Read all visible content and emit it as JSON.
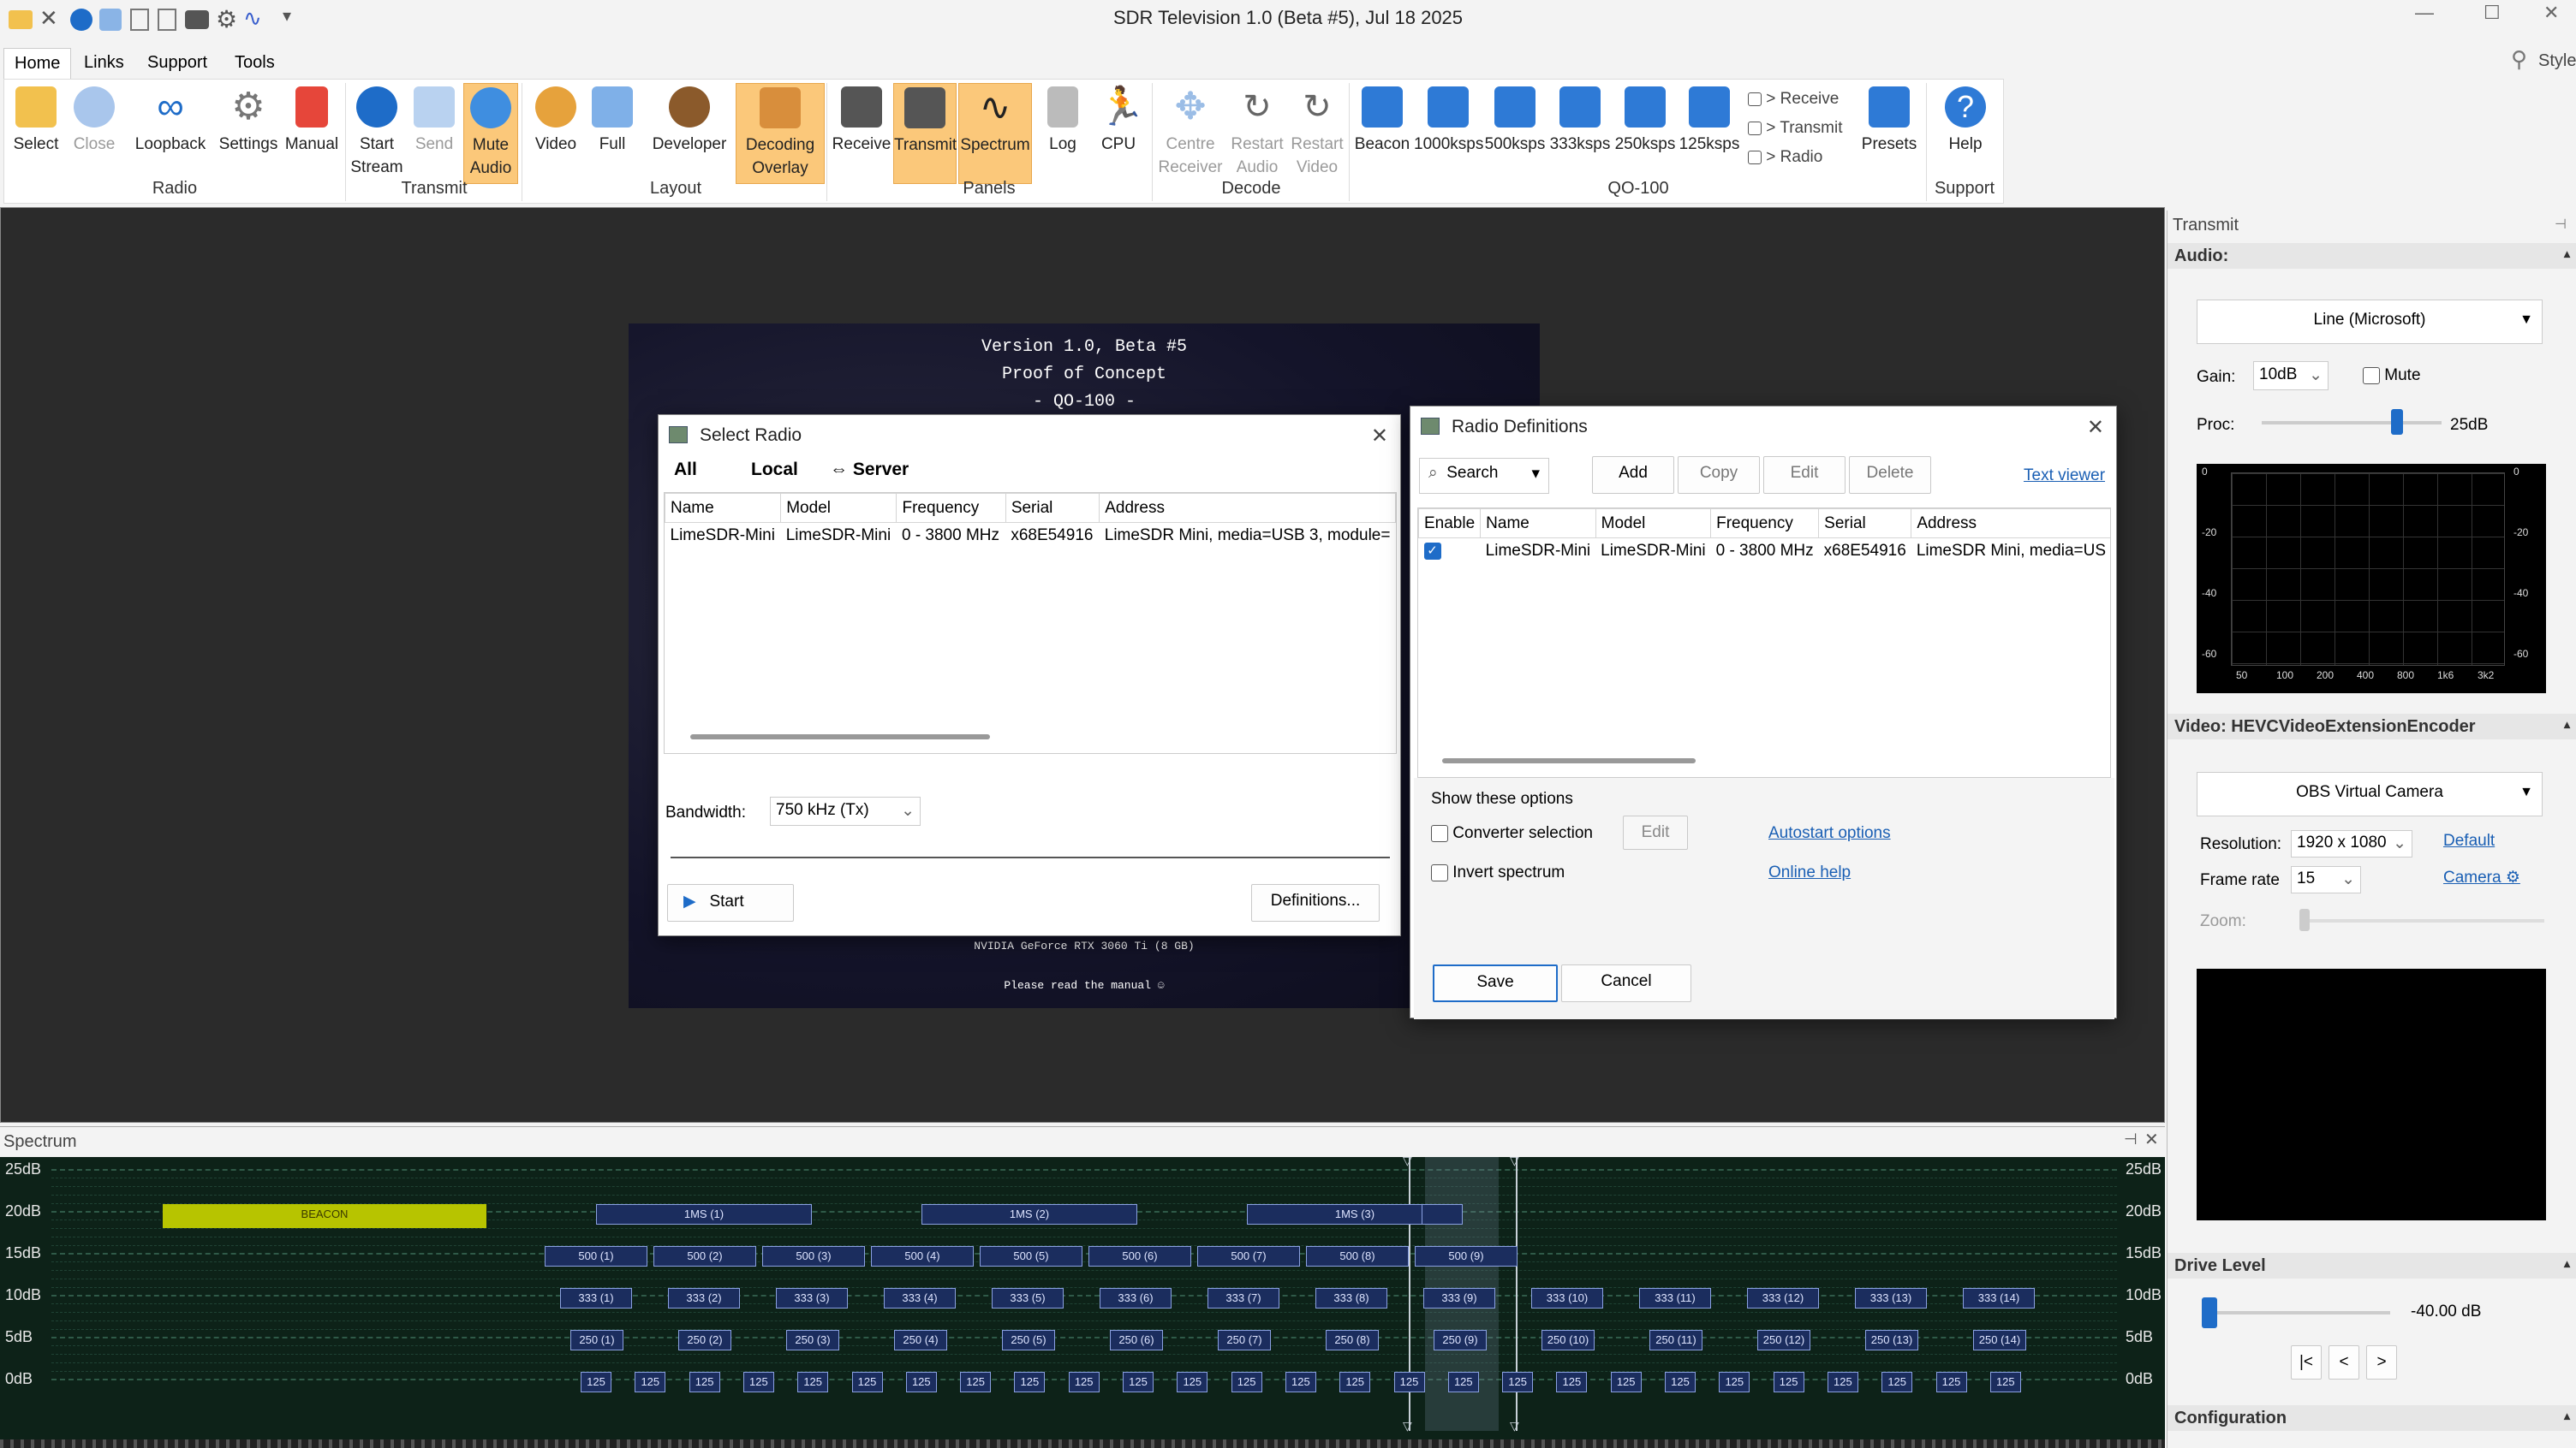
{
  "app": {
    "title": "SDR Television 1.0 (Beta #5), Jul 18 2025",
    "style_label": "Style"
  },
  "menus": [
    "Home",
    "Links",
    "Support",
    "Tools"
  ],
  "ribbon": {
    "buttons": {
      "select": "Select",
      "close": "Close",
      "loopback": "Loopback",
      "settings": "Settings",
      "manual": "Manual",
      "start_stream_1": "Start",
      "start_stream_2": "Stream",
      "send": "Send",
      "mute_1": "Mute",
      "mute_2": "Audio",
      "video": "Video",
      "full": "Full",
      "developer": "Developer",
      "decoding_1": "Decoding",
      "decoding_2": "Overlay",
      "receive": "Receive",
      "transmit": "Transmit",
      "spectrum": "Spectrum",
      "log": "Log",
      "cpu": "CPU",
      "centre_1": "Centre",
      "centre_2": "Receiver",
      "restart_audio_1": "Restart",
      "restart_audio_2": "Audio",
      "restart_video_1": "Restart",
      "restart_video_2": "Video",
      "beacon": "Beacon",
      "k1000": "1000ksps",
      "k500": "500ksps",
      "k333": "333ksps",
      "k250": "250ksps",
      "k125": "125ksps",
      "presets": "Presets",
      "help": "Help"
    },
    "checks": [
      "> Receive",
      "> Transmit",
      "> Radio"
    ],
    "groups": {
      "radio": "Radio",
      "transmit": "Transmit",
      "layout": "Layout",
      "panels": "Panels",
      "decode": "Decode",
      "qo100": "QO-100",
      "support": "Support"
    }
  },
  "splash": {
    "line1": "Version 1.0, Beta #5",
    "line2": "Proof of Concept",
    "line3": "- QO-100 -",
    "gpu": "NVIDIA GeForce RTX 3060 Ti (8 GB)",
    "manual": "Please read the manual ☺"
  },
  "select_radio": {
    "title": "Select Radio",
    "tabs": {
      "all": "All",
      "local": "Local",
      "server": "⇔ Server"
    },
    "columns": [
      "Name",
      "Model",
      "Frequency",
      "Serial",
      "Address"
    ],
    "rows": [
      [
        "LimeSDR-Mini",
        "LimeSDR-Mini",
        "0 - 3800 MHz",
        "x68E54916",
        "LimeSDR Mini, media=USB 3, module="
      ]
    ],
    "bandwidth_label": "Bandwidth:",
    "bandwidth_value": "750 kHz (Tx)",
    "start": "Start",
    "definitions": "Definitions..."
  },
  "radio_defs": {
    "title": "Radio Definitions",
    "search": "Search",
    "add": "Add",
    "copy": "Copy",
    "edit": "Edit",
    "delete": "Delete",
    "text_viewer": "Text viewer",
    "columns": [
      "Enable",
      "Name",
      "Model",
      "Frequency",
      "Serial",
      "Address"
    ],
    "rows": [
      [
        "",
        "LimeSDR-Mini",
        "LimeSDR-Mini",
        "0 - 3800 MHz",
        "x68E54916",
        "LimeSDR Mini, media=US"
      ]
    ],
    "options_title": "Show these options",
    "converter": "Converter selection",
    "converter_edit": "Edit",
    "invert": "Invert spectrum",
    "autostart": "Autostart options",
    "online_help": "Online help",
    "save": "Save",
    "cancel": "Cancel"
  },
  "transmit_panel": {
    "header": "Transmit",
    "audio_header": "Audio:",
    "audio_device": "Line (Microsoft)",
    "gain_label": "Gain:",
    "gain_value": "10dB",
    "mute": "Mute",
    "proc_label": "Proc:",
    "proc_value": "25dB",
    "proc_level": 0.75,
    "graph_y": [
      "0",
      "-20",
      "-40",
      "-60"
    ],
    "graph_x": [
      "50",
      "100",
      "200",
      "400",
      "800",
      "1k6",
      "3k2"
    ],
    "video_header": "Video: HEVCVideoExtensionEncoder",
    "video_device": "OBS Virtual Camera",
    "resolution_label": "Resolution:",
    "resolution_value": "1920 x 1080",
    "default_link": "Default",
    "framerate_label": "Frame rate",
    "framerate_value": "15",
    "camera_link": "Camera ⚙",
    "zoom_label": "Zoom:",
    "drive_header": "Drive Level",
    "drive_value": "-40.00 dB",
    "drive_level": 0.0,
    "nav": [
      "|<",
      "<",
      ">"
    ],
    "config_header": "Configuration"
  },
  "spectrum": {
    "header": "Spectrum",
    "db_labels": [
      "25dB",
      "20dB",
      "15dB",
      "10dB",
      "5dB",
      "0dB"
    ],
    "beacon": "BEACON",
    "ms": [
      "1MS (1)",
      "1MS (2)",
      "1MS (3)"
    ],
    "k500": [
      "500 (1)",
      "500 (2)",
      "500 (3)",
      "500 (4)",
      "500 (5)",
      "500 (6)",
      "500 (7)",
      "500 (8)",
      "500 (9)"
    ],
    "k333": [
      "333 (1)",
      "333 (2)",
      "333 (3)",
      "333 (4)",
      "333 (5)",
      "333 (6)",
      "333 (7)",
      "333 (8)",
      "333 (9)",
      "333 (10)",
      "333 (11)",
      "333 (12)",
      "333 (13)",
      "333 (14)"
    ],
    "k250": [
      "250 (1)",
      "250 (2)",
      "250 (3)",
      "250 (4)",
      "250 (5)",
      "250 (6)",
      "250 (7)",
      "250 (8)",
      "250 (9)",
      "250 (10)",
      "250 (11)",
      "250 (12)",
      "250 (13)",
      "250 (14)"
    ],
    "k125": "125"
  },
  "colors": {
    "accent": "#1e6cc8",
    "highlight": "#fbc87a",
    "beacon": "#b7c400",
    "spectrum_bg": "#0d2218"
  }
}
